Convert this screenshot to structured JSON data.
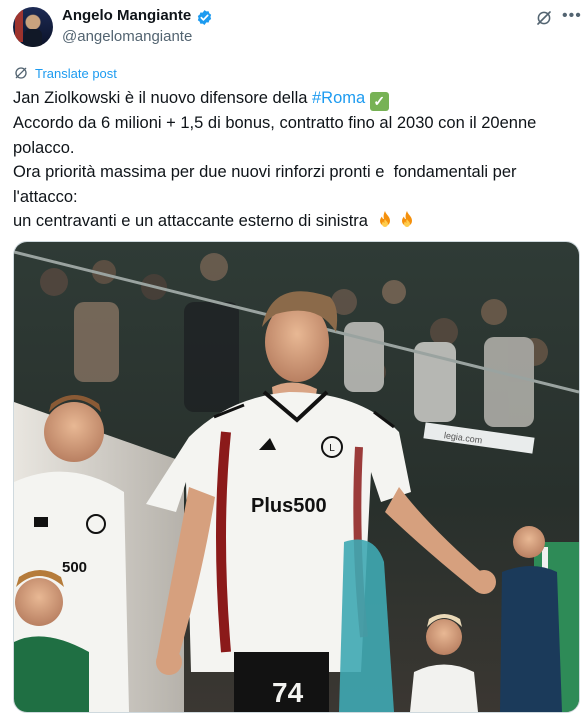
{
  "author": {
    "name": "Angelo Mangiante",
    "handle": "@angelomangiante"
  },
  "actions": {
    "translate_label": "Translate post"
  },
  "tweet": {
    "line1_text": "Jan Ziolkowski è il nuovo difensore della ",
    "line1_hashtag": "#Roma",
    "line2": "Accordo da 6 milioni + 1,5 di bonus, contratto fino al 2030 con il 20enne",
    "line3": "polacco.",
    "line4": "Ora priorità massima per due nuovi rinforzi pronti e  fondamentali per",
    "line5": "l'attacco:",
    "line6": "un centravanti e un attaccante esterno di sinistra "
  },
  "photo": {
    "jersey_sponsor": "Plus500",
    "jersey_number": "74",
    "stadium_banner": "legia.com",
    "colors": {
      "shirt": "#f4f4f1",
      "shorts": "#121212",
      "accent": "#8b1a1a",
      "crowd": "#2c3330"
    }
  },
  "colors": {
    "link": "#1d9bf0",
    "verified": "#1d9bf0",
    "muted": "#536471"
  }
}
